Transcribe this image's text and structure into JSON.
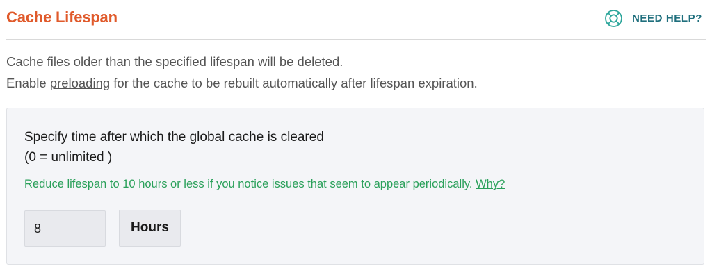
{
  "header": {
    "title": "Cache Lifespan",
    "help_label": "NEED HELP?",
    "help_icon": "lifebuoy-icon"
  },
  "description": {
    "line1": "Cache files older than the specified lifespan will be deleted.",
    "line2_before": "Enable ",
    "line2_link": "preloading",
    "line2_after": " for the cache to be rebuilt automatically after lifespan expiration."
  },
  "setting": {
    "label_line1": "Specify time after which the global cache is cleared",
    "label_line2": "(0 = unlimited )",
    "hint_text": "Reduce lifespan to 10 hours or less if you notice issues that seem to appear periodically.",
    "hint_link": "Why?",
    "value": "8",
    "unit": "Hours"
  },
  "colors": {
    "title": "#e05a2b",
    "help": "#1f6f7d",
    "hint": "#2aa05a"
  }
}
